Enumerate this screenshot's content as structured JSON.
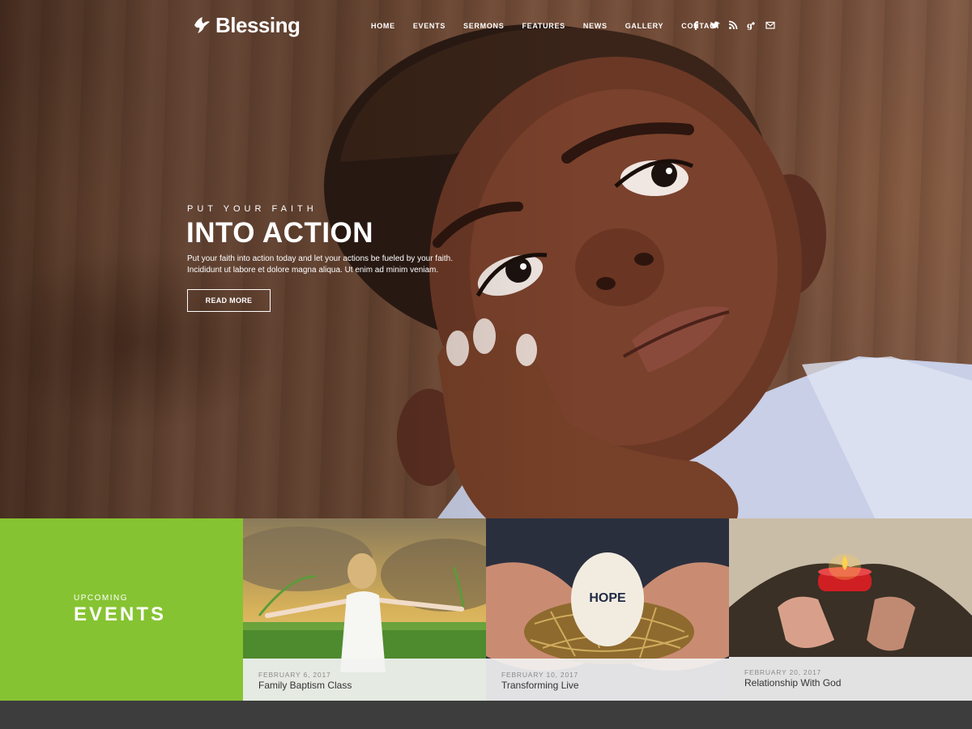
{
  "brand": {
    "name": "Blessing",
    "logo_icon": "dove-icon"
  },
  "nav": {
    "items": [
      "HOME",
      "EVENTS",
      "SERMONS",
      "FEATURES",
      "NEWS",
      "GALLERY",
      "CONTACT"
    ],
    "social_icons": [
      "facebook-icon",
      "twitter-icon",
      "rss-icon",
      "google-plus-icon",
      "envelope-icon"
    ]
  },
  "hero": {
    "kicker": "PUT YOUR FAITH",
    "title": "INTO ACTION",
    "text_line1": "Put your faith into action today and let your actions be fueled by your faith.",
    "text_line2": "Incididunt ut labore et dolore magna aliqua. Ut enim ad minim veniam.",
    "button_label": "READ MORE"
  },
  "events": {
    "kicker": "UPCOMING",
    "title": "EVENTS",
    "accent_color": "#86c332",
    "items": [
      {
        "date": "FEBRUARY 6, 2017",
        "title": "Family Baptism Class"
      },
      {
        "date": "FEBRUARY 10, 2017",
        "title": "Transforming Live",
        "egg_text": "HOPE"
      },
      {
        "date": "FEBRUARY 20, 2017",
        "title": "Relationship With God"
      }
    ]
  }
}
